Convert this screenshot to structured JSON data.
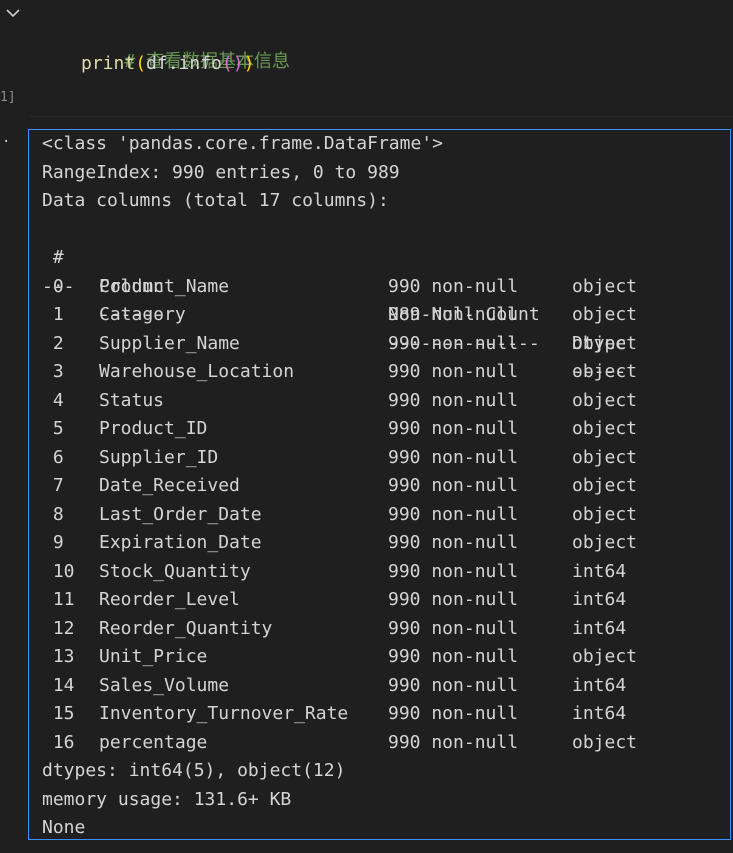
{
  "cell": {
    "execution_count": "1]",
    "comment_line": "# 查看数据基本信息",
    "code": {
      "fn": "print",
      "arg": "df.info",
      "call_parens": "()"
    }
  },
  "output": {
    "class_line": "<class 'pandas.core.frame.DataFrame'>",
    "range_index": "RangeIndex: 990 entries, 0 to 989",
    "data_columns": "Data columns (total 17 columns):",
    "headers": {
      "idx": " #",
      "column": "Column",
      "non_null": "Non-Null Count",
      "dtype": "Dtype"
    },
    "separators": {
      "idx": "---",
      "column": "------",
      "non_null": "--------------",
      "dtype": "-----"
    },
    "rows": [
      {
        "idx": "0",
        "column": "Product_Name",
        "non_null": "990 non-null",
        "dtype": "object"
      },
      {
        "idx": "1",
        "column": "Catagory",
        "non_null": "989 non-null",
        "dtype": "object"
      },
      {
        "idx": "2",
        "column": "Supplier_Name",
        "non_null": "990 non-null",
        "dtype": "object"
      },
      {
        "idx": "3",
        "column": "Warehouse_Location",
        "non_null": "990 non-null",
        "dtype": "object"
      },
      {
        "idx": "4",
        "column": "Status",
        "non_null": "990 non-null",
        "dtype": "object"
      },
      {
        "idx": "5",
        "column": "Product_ID",
        "non_null": "990 non-null",
        "dtype": "object"
      },
      {
        "idx": "6",
        "column": "Supplier_ID",
        "non_null": "990 non-null",
        "dtype": "object"
      },
      {
        "idx": "7",
        "column": "Date_Received",
        "non_null": "990 non-null",
        "dtype": "object"
      },
      {
        "idx": "8",
        "column": "Last_Order_Date",
        "non_null": "990 non-null",
        "dtype": "object"
      },
      {
        "idx": "9",
        "column": "Expiration_Date",
        "non_null": "990 non-null",
        "dtype": "object"
      },
      {
        "idx": "10",
        "column": "Stock_Quantity",
        "non_null": "990 non-null",
        "dtype": "int64"
      },
      {
        "idx": "11",
        "column": "Reorder_Level",
        "non_null": "990 non-null",
        "dtype": "int64"
      },
      {
        "idx": "12",
        "column": "Reorder_Quantity",
        "non_null": "990 non-null",
        "dtype": "int64"
      },
      {
        "idx": "13",
        "column": "Unit_Price",
        "non_null": "990 non-null",
        "dtype": "object"
      },
      {
        "idx": "14",
        "column": "Sales_Volume",
        "non_null": "990 non-null",
        "dtype": "int64"
      },
      {
        "idx": "15",
        "column": "Inventory_Turnover_Rate",
        "non_null": "990 non-null",
        "dtype": "int64"
      },
      {
        "idx": "16",
        "column": "percentage",
        "non_null": "990 non-null",
        "dtype": "object"
      }
    ],
    "dtypes_line": "dtypes: int64(5), object(12)",
    "memory_line": "memory usage: 131.6+ KB",
    "return_line": "None"
  }
}
